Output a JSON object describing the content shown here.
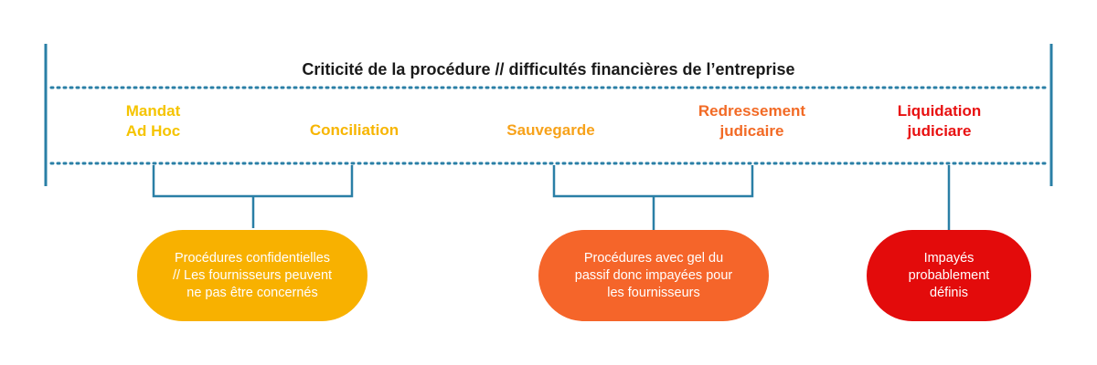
{
  "title": "Criticité de la procédure // difficultés financières de l’entreprise",
  "stages": [
    {
      "label": "Mandat\nAd Hoc",
      "color": "#f5c400"
    },
    {
      "label": "Conciliation",
      "color": "#f7b500"
    },
    {
      "label": "Sauvegarde",
      "color": "#f7a21a"
    },
    {
      "label": "Redressement\njudicaire",
      "color": "#f26a25"
    },
    {
      "label": "Liquidation\njudiciare",
      "color": "#e81010"
    }
  ],
  "groups": [
    {
      "text": "Procédures confidentielles\n// Les fournisseurs peuvent\nne pas être concernés",
      "color": "#f8b100"
    },
    {
      "text": "Procédures avec gel du\npassif donc impayées pour\nles fournisseurs",
      "color": "#f5652a"
    },
    {
      "text": "Impayés\nprobablement\ndéfinis",
      "color": "#e30b0b"
    }
  ],
  "colors": {
    "frame": "#2a7fa6",
    "dots": "#2a7fa6"
  }
}
